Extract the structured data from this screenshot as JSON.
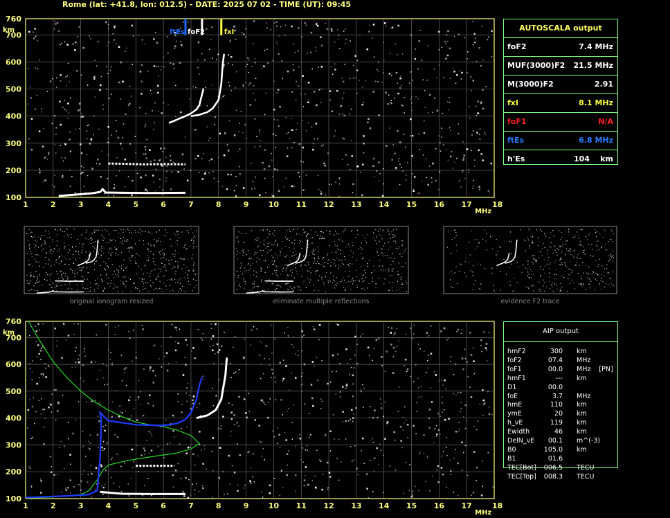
{
  "header": "Rome (lat: +41.8, lon: 012.5) - DATE: 2025 07 02 - TIME (UT): 09:45",
  "axes": {
    "x_ticks": [
      "1",
      "2",
      "3",
      "4",
      "5",
      "6",
      "7",
      "8",
      "9",
      "10",
      "11",
      "12",
      "13",
      "14",
      "15",
      "16",
      "17",
      "18"
    ],
    "y_ticks": [
      "100",
      "200",
      "300",
      "400",
      "500",
      "600",
      "700",
      "760"
    ],
    "x_unit": "MHz",
    "y_unit": "km"
  },
  "markers": {
    "ftEs": {
      "label": "ftEs",
      "freq": 6.8,
      "color": "#1e6cff"
    },
    "foF2": {
      "label": "foF2",
      "freq": 7.4,
      "color": "#ffffff"
    },
    "fxI": {
      "label": "fxI",
      "freq": 8.1,
      "color": "#ffff40"
    }
  },
  "autoscala": {
    "title": "AUTOSCALA output",
    "rows": [
      {
        "label": "foF2",
        "value": "7.4 MHz",
        "color": "#ffffff"
      },
      {
        "label": "MUF(3000)F2",
        "value": "21.5 MHz",
        "color": "#ffffff"
      },
      {
        "label": "M(3000)F2",
        "value": "2.91",
        "color": "#ffffff"
      },
      {
        "label": "fxI",
        "value": "8.1 MHz",
        "color": "#ffff40"
      },
      {
        "label": "foF1",
        "value": "N/A",
        "color": "#ff2020"
      },
      {
        "label": "ftEs",
        "value": "6.8 MHz",
        "color": "#2a7bff"
      },
      {
        "label": "h'Es",
        "value": "104    km",
        "color": "#ffffff"
      }
    ]
  },
  "thumbnails": {
    "captions": [
      "original ionogram resized",
      "eliminate multiple reflections",
      "evidence F2 trace"
    ]
  },
  "aip": {
    "title": "AIP output",
    "rows": [
      {
        "name": "hmF2",
        "value": "300",
        "unit": "km"
      },
      {
        "name": "foF2",
        "value": "07.4",
        "unit": "MHz"
      },
      {
        "name": "foF1",
        "value": "00.0",
        "unit": "MHz    [PN]"
      },
      {
        "name": "hmF1",
        "value": "---",
        "unit": "km"
      },
      {
        "name": "D1",
        "value": "00.0",
        "unit": ""
      },
      {
        "name": "foE",
        "value": "3.7",
        "unit": "MHz"
      },
      {
        "name": "hmE",
        "value": "110",
        "unit": "km"
      },
      {
        "name": "ymE",
        "value": "20",
        "unit": "km"
      },
      {
        "name": "h_vE",
        "value": "119",
        "unit": "km"
      },
      {
        "name": "Ewidth",
        "value": "46",
        "unit": "km"
      },
      {
        "name": "DelN_vE",
        "value": "00.1",
        "unit": "m^(-3)"
      },
      {
        "name": "B0",
        "value": "105.0",
        "unit": "km"
      },
      {
        "name": "B1",
        "value": "01.6",
        "unit": ""
      },
      {
        "name": "TEC[Bot]",
        "value": "006.5",
        "unit": "TECU"
      },
      {
        "name": "TEC[Top]",
        "value": "008.3",
        "unit": "TECU"
      }
    ]
  },
  "chart_data": [
    {
      "type": "scatter",
      "title": "",
      "xlabel": "MHz",
      "ylabel": "km",
      "xlim": [
        1,
        18
      ],
      "ylim": [
        100,
        760
      ],
      "grid": true,
      "series": [
        {
          "values": [
            [
              6.2,
              375
            ],
            [
              6.4,
              383
            ],
            [
              6.6,
              392
            ],
            [
              6.8,
              400
            ],
            [
              7.0,
              410
            ],
            [
              7.2,
              425
            ],
            [
              7.3,
              440
            ],
            [
              7.35,
              460
            ],
            [
              7.4,
              480
            ],
            [
              7.45,
              500
            ]
          ]
        },
        {
          "values": [
            [
              7.0,
              400
            ],
            [
              7.3,
              405
            ],
            [
              7.6,
              415
            ],
            [
              7.8,
              430
            ],
            [
              8.0,
              460
            ],
            [
              8.1,
              520
            ],
            [
              8.15,
              590
            ],
            [
              8.2,
              630
            ]
          ]
        },
        {
          "values": [
            [
              2.2,
              105
            ],
            [
              2.8,
              110
            ],
            [
              3.4,
              115
            ],
            [
              3.7,
              120
            ],
            [
              3.8,
              130
            ],
            [
              3.9,
              118
            ],
            [
              4.5,
              117
            ],
            [
              5.5,
              116
            ],
            [
              6.8,
              117
            ]
          ]
        },
        {
          "values": [
            [
              4.0,
              225
            ],
            [
              4.6,
              224
            ],
            [
              5.2,
              222
            ],
            [
              6.0,
              223
            ],
            [
              6.8,
              222
            ]
          ]
        }
      ]
    },
    {
      "type": "line",
      "title": "",
      "xlabel": "MHz",
      "ylabel": "km",
      "xlim": [
        1,
        18
      ],
      "ylim": [
        100,
        760
      ],
      "grid": true,
      "series": [
        {
          "values": [
            [
              1.1,
              760
            ],
            [
              1.5,
              690
            ],
            [
              2.0,
              610
            ],
            [
              2.5,
              550
            ],
            [
              3.0,
              500
            ],
            [
              3.5,
              460
            ],
            [
              4.0,
              430
            ],
            [
              4.5,
              405
            ],
            [
              5.0,
              385
            ],
            [
              5.5,
              375
            ],
            [
              6.0,
              368
            ],
            [
              6.5,
              355
            ],
            [
              7.0,
              335
            ],
            [
              7.3,
              305
            ],
            [
              7.0,
              285
            ],
            [
              6.5,
              270
            ],
            [
              5.5,
              255
            ],
            [
              4.7,
              242
            ],
            [
              4.0,
              225
            ],
            [
              3.8,
              205
            ],
            [
              3.6,
              170
            ],
            [
              3.3,
              130
            ],
            [
              3.0,
              115
            ],
            [
              2.0,
              106
            ],
            [
              1.0,
              102
            ]
          ]
        },
        {
          "values": [
            [
              1.0,
              104
            ],
            [
              2.5,
              110
            ],
            [
              3.3,
              115
            ],
            [
              3.6,
              130
            ],
            [
              3.7,
              250
            ],
            [
              3.75,
              390
            ],
            [
              3.7,
              420
            ],
            [
              4.0,
              390
            ],
            [
              5.0,
              375
            ],
            [
              6.0,
              372
            ],
            [
              6.5,
              380
            ],
            [
              6.8,
              395
            ],
            [
              7.0,
              420
            ],
            [
              7.2,
              470
            ],
            [
              7.3,
              520
            ],
            [
              7.4,
              553
            ]
          ]
        },
        {
          "values": [
            [
              7.2,
              400
            ],
            [
              7.6,
              410
            ],
            [
              7.9,
              430
            ],
            [
              8.1,
              470
            ],
            [
              8.2,
              530
            ],
            [
              8.25,
              560
            ],
            [
              8.3,
              625
            ]
          ]
        },
        {
          "values": [
            [
              3.7,
              125
            ],
            [
              4.5,
              118
            ],
            [
              5.5,
              117
            ],
            [
              6.8,
              117
            ]
          ]
        },
        {
          "values": [
            [
              5.0,
              222
            ],
            [
              5.6,
              222
            ],
            [
              6.4,
              222
            ]
          ]
        }
      ]
    }
  ]
}
